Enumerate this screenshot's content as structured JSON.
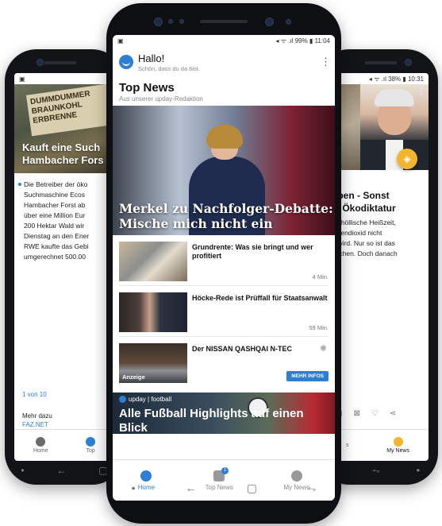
{
  "left_phone": {
    "hero_sign": "DUMMDUMMER BRAUNKOHL ERBRENNE",
    "headline_line1": "Kauft eine Such",
    "headline_line2": "Hambacher Fors",
    "body_lines": [
      "Die Betreiber der öko",
      "Suchmaschine Ecos",
      "Hambacher Forst ab",
      "über eine Million Eur",
      "200 Hektar Wald wir",
      "Dienstag an den Ener",
      "RWE kaufte das Gebi",
      "umgerechnet 500.00"
    ],
    "pager": "1 von 10",
    "more_label": "Mehr dazu",
    "source": "FAZ.NET",
    "nav": {
      "home": "Home",
      "top": "Top"
    }
  },
  "right_phone": {
    "status": {
      "battery": "38%",
      "time": "10:31"
    },
    "headline_line1": "ppen - Sonst",
    "headline_line2": "ie Ökodiktatur",
    "body_lines": [
      "he höllische Heißzeit,",
      "ohlendioxid nicht",
      "rt wird. Nur so ist das",
      "reichen. Doch danach"
    ],
    "nav": {
      "left": "s",
      "my_news": "My News"
    }
  },
  "center_phone": {
    "status": {
      "battery": "99%",
      "time": "11:04"
    },
    "greeting": {
      "hello": "Hallo!",
      "sub": "Schön, dass du da bist."
    },
    "section_title": "Top News",
    "section_sub": "Aus unserer upday-Redaktion",
    "hero_headline": "Merkel zu Nachfolger-Debatte: Mische mich nicht ein",
    "articles": [
      {
        "title": "Grundrente: Was sie bringt und wer profitiert",
        "meta": "4 Min."
      },
      {
        "title": "Höcke-Rede ist Prüffall für Staatsanwalt",
        "meta": "59 Min."
      }
    ],
    "ad": {
      "title": "Der NISSAN QASHQAI N-TEC",
      "label": "Anzeige",
      "cta": "MEHR INFOS"
    },
    "football": {
      "tag": "upday | football",
      "headline": "Alle Fußball Highlights auf einen Blick"
    },
    "nav": {
      "home": "Home",
      "top_news": "Top News",
      "my_news": "My News",
      "badge": "1"
    }
  },
  "colors": {
    "accent": "#2d7fd3",
    "my_news_accent": "#f2b530"
  }
}
